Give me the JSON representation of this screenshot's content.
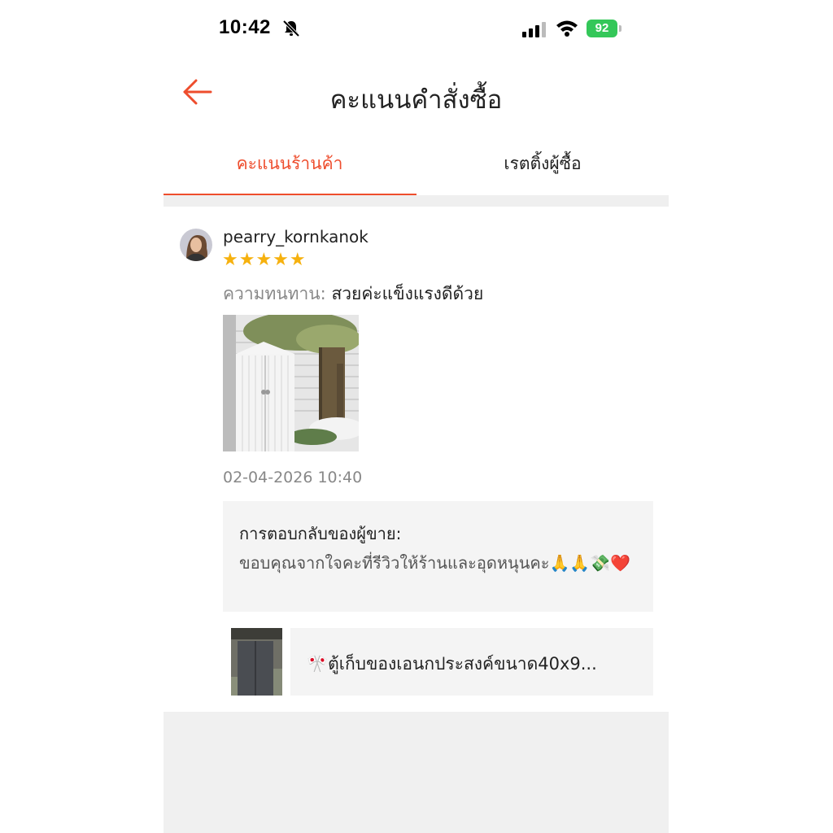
{
  "status_bar": {
    "time": "10:42",
    "battery": "92"
  },
  "header": {
    "title": "คะแนนคำสั่งซื้อ",
    "back_icon": "arrow-left-icon"
  },
  "tabs": [
    {
      "label": "คะแนนร้านค้า",
      "active": true
    },
    {
      "label": "เรตติ้งผู้ซื้อ",
      "active": false
    }
  ],
  "review": {
    "username": "pearry_kornkanok",
    "rating": 5,
    "stars": "★★★★★",
    "label": "ความทนทาน:",
    "text": "สวยค่ะแข็งแรงดีด้วย",
    "timestamp": "02-04-2026 10:40"
  },
  "seller_reply": {
    "label": "การตอบกลับของผู้ขาย:",
    "text": "ขอบคุณจากใจคะที่รีวิวให้ร้านและอุดหนุนคะ🙏🙏💸❤️"
  },
  "product": {
    "title": "🎌ตู้เก็บของเอนกประสงค์ขนาด40x9..."
  },
  "colors": {
    "accent": "#ee4d2d",
    "star": "#f6b10e",
    "battery": "#34c759"
  }
}
